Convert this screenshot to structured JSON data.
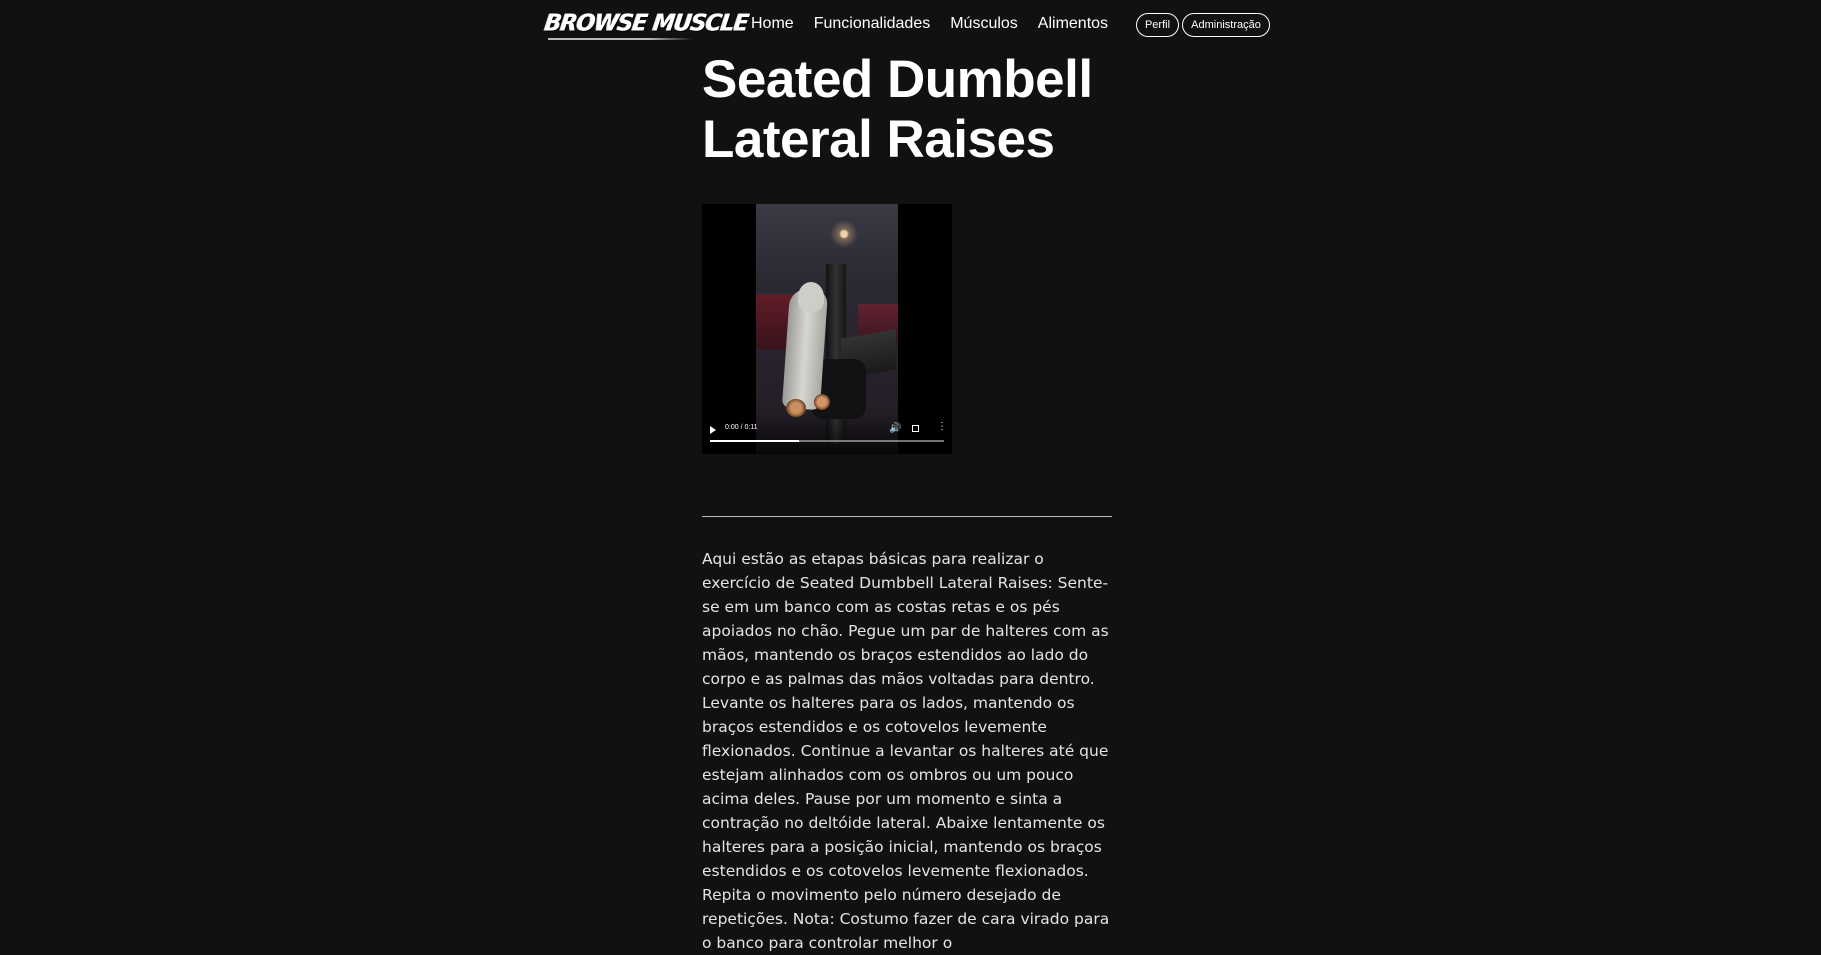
{
  "header": {
    "logo_text": "BROWSE MUSCLE",
    "nav": [
      {
        "label": "Home"
      },
      {
        "label": "Funcionalidades"
      },
      {
        "label": "Músculos"
      },
      {
        "label": "Alimentos"
      }
    ],
    "perfil_label": "Perfil",
    "admin_label": "Administração"
  },
  "main": {
    "title": "Seated Dumbell Lateral Raises",
    "video": {
      "time": "0:00 / 0:11",
      "progress_fraction": 0.38
    },
    "description": "Aqui estão as etapas básicas para realizar o exercício de Seated Dumbbell Lateral Raises: Sente-se em um banco com as costas retas e os pés apoiados no chão. Pegue um par de halteres com as mãos, mantendo os braços estendidos ao lado do corpo e as palmas das mãos voltadas para dentro. Levante os halteres para os lados, mantendo os braços estendidos e os cotovelos levemente flexionados. Continue a levantar os halteres até que estejam alinhados com os ombros ou um pouco acima deles. Pause por um momento e sinta a contração no deltóide lateral. Abaixe lentamente os halteres para a posição inicial, mantendo os braços estendidos e os cotovelos levemente flexionados. Repita o movimento pelo número desejado de repetições. Nota: Costumo fazer de cara virado para o banco para controlar melhor o"
  },
  "colors": {
    "background": "#111111",
    "text": "#ffffff",
    "body_text": "#e4e4e4"
  }
}
